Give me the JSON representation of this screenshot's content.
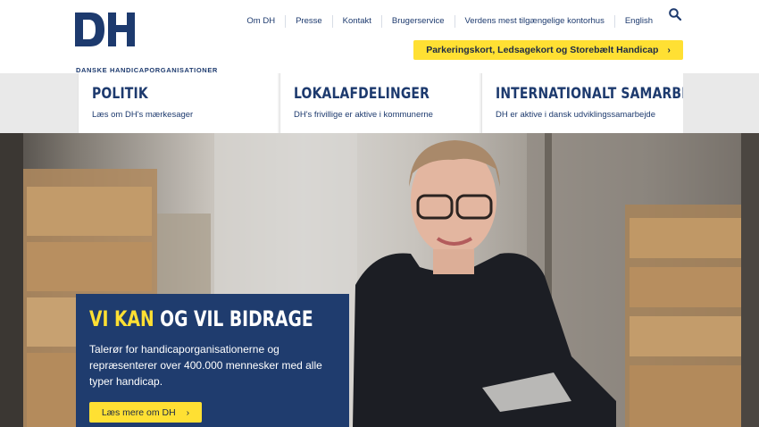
{
  "brand": {
    "logo_letters": "DH",
    "name": "DANSKE HANDICAPORGANISATIONER",
    "navy": "#1d3a6e",
    "yellow": "#ffe033"
  },
  "topnav": {
    "items": [
      "Om DH",
      "Presse",
      "Kontakt",
      "Brugerservice",
      "Verdens mest tilgængelige kontorhus",
      "English"
    ],
    "search_icon": "search-icon"
  },
  "cta_top": {
    "label": "Parkeringskort, Ledsagekort og Storebælt Handicap",
    "icon": "chevron-right-icon"
  },
  "cards": [
    {
      "title": "POLITIK",
      "subtitle": "Læs om DH's mærkesager"
    },
    {
      "title": "LOKALAFDELINGER",
      "subtitle": "DH's frivillige er aktive i kommunerne"
    },
    {
      "title": "INTERNATIONALT SAMARBEJDE",
      "subtitle": "DH er aktive i dansk udviklingssamarbejde"
    }
  ],
  "hero": {
    "title_accent": "VI KAN",
    "title_rest": " OG VIL BIDRAGE",
    "text": "Talerør for handicaporganisationerne og repræsenterer over 400.000 mennesker med alle typer handicap.",
    "button_label": "Læs mere om DH",
    "button_icon": "chevron-right-icon"
  }
}
